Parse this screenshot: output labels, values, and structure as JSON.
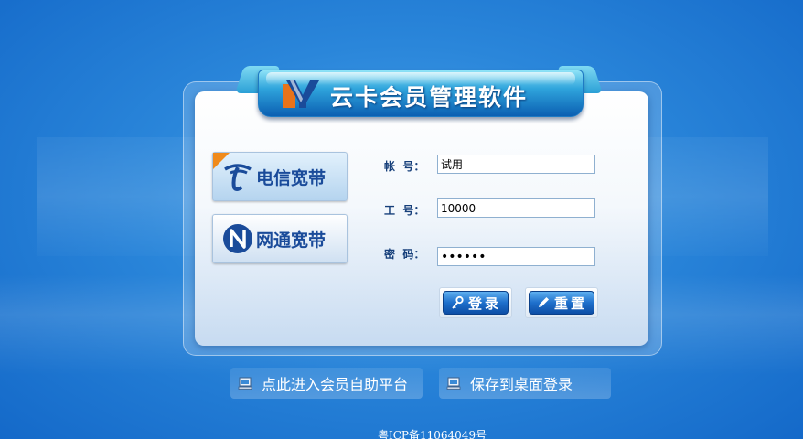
{
  "app": {
    "title": "云卡会员管理软件"
  },
  "isp": {
    "telecom_label": "电信宽带",
    "netcom_label": "网通宽带"
  },
  "form": {
    "account_label": "帐  号：",
    "account_value": "试用",
    "employee_label": "工  号：",
    "employee_value": "10000",
    "password_label": "密  码：",
    "password_value": "123456"
  },
  "buttons": {
    "login_label": "登录",
    "reset_label": "重置"
  },
  "links": {
    "self_service_label": "点此进入会员自助平台",
    "desktop_label": "保存到桌面登录"
  },
  "footer": {
    "icp": "粤ICP备11064049号"
  },
  "colors": {
    "accent": "#1e6fcb",
    "background": "#2a86da",
    "logo_orange": "#e8731a",
    "logo_blue": "#1a4b9a"
  }
}
